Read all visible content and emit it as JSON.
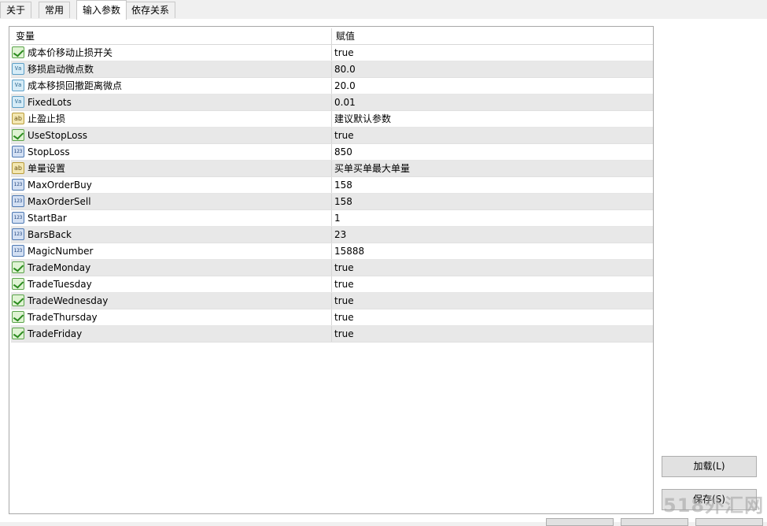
{
  "tabs": [
    {
      "label": "关于"
    },
    {
      "label": "常用"
    },
    {
      "label": "输入参数"
    },
    {
      "label": "依存关系"
    }
  ],
  "grid": {
    "col_variable": "变量",
    "col_value": "赋值",
    "rows": [
      {
        "type": "bool",
        "icon": "bool-icon",
        "name": "成本价移动止损开关",
        "value": "true"
      },
      {
        "type": "double",
        "icon": "double-icon",
        "name": "移损启动微点数",
        "value": "80.0"
      },
      {
        "type": "double",
        "icon": "double-icon",
        "name": "成本移损回撤距离微点",
        "value": "20.0"
      },
      {
        "type": "double",
        "icon": "double-icon",
        "name": "FixedLots",
        "value": "0.01"
      },
      {
        "type": "string",
        "icon": "string-icon",
        "name": "止盈止损",
        "value": "建议默认参数"
      },
      {
        "type": "bool",
        "icon": "bool-icon",
        "name": "UseStopLoss",
        "value": "true"
      },
      {
        "type": "int",
        "icon": "int-icon",
        "name": "StopLoss",
        "value": "850"
      },
      {
        "type": "string",
        "icon": "string-icon",
        "name": "单量设置",
        "value": "买单买单最大单量"
      },
      {
        "type": "int",
        "icon": "int-icon",
        "name": "MaxOrderBuy",
        "value": "158"
      },
      {
        "type": "int",
        "icon": "int-icon",
        "name": "MaxOrderSell",
        "value": "158"
      },
      {
        "type": "int",
        "icon": "int-icon",
        "name": "StartBar",
        "value": "1"
      },
      {
        "type": "int",
        "icon": "int-icon",
        "name": "BarsBack",
        "value": "23"
      },
      {
        "type": "int",
        "icon": "int-icon",
        "name": "MagicNumber",
        "value": "15888"
      },
      {
        "type": "bool",
        "icon": "bool-icon",
        "name": "TradeMonday",
        "value": "true"
      },
      {
        "type": "bool",
        "icon": "bool-icon",
        "name": "TradeTuesday",
        "value": "true"
      },
      {
        "type": "bool",
        "icon": "bool-icon",
        "name": "TradeWednesday",
        "value": "true"
      },
      {
        "type": "bool",
        "icon": "bool-icon",
        "name": "TradeThursday",
        "value": "true"
      },
      {
        "type": "bool",
        "icon": "bool-icon",
        "name": "TradeFriday",
        "value": "true"
      }
    ]
  },
  "buttons": {
    "load": "加载(L)",
    "save": "保存(S)"
  },
  "watermark": "518外汇网"
}
